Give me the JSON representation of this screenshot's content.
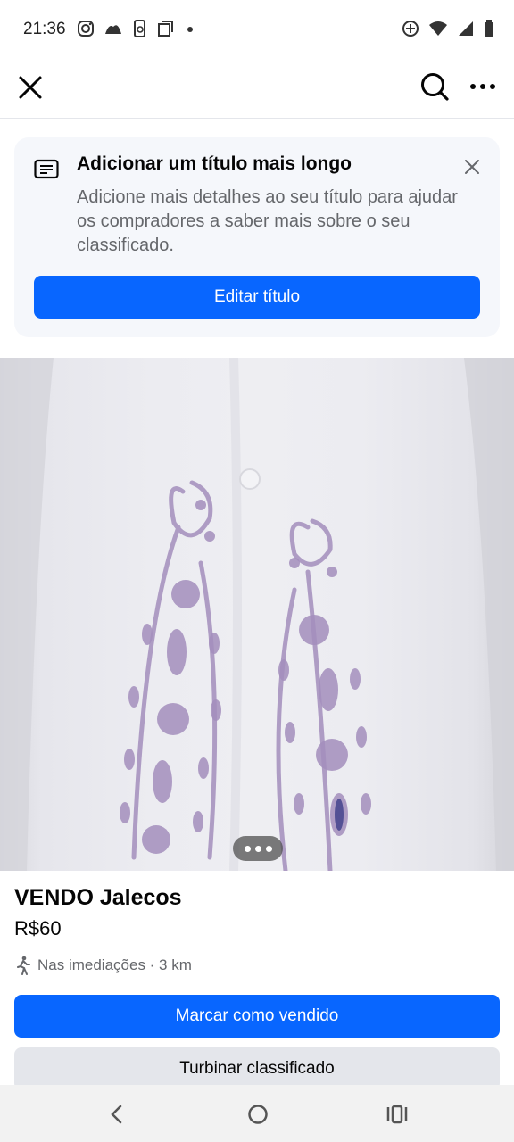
{
  "status_bar": {
    "time": "21:36",
    "left_icons": [
      "instagram-icon",
      "bank-icon",
      "phone-sync-icon",
      "copy-icon",
      "dot-icon"
    ],
    "right_icons": [
      "add-circle-icon",
      "wifi-icon",
      "signal-icon",
      "battery-icon"
    ]
  },
  "top_bar": {
    "close_icon": "close-icon",
    "search_icon": "search-icon",
    "more_icon": "more-icon"
  },
  "banner": {
    "icon": "text-lines-icon",
    "title": "Adicionar um título mais longo",
    "body": "Adicione mais detalhes ao seu título para ajudar os compradores a saber mais sobre o seu classificado.",
    "button_label": "Editar título",
    "close_icon": "close-icon"
  },
  "listing": {
    "photo_icon": "more-photos-icon",
    "title": "VENDO Jalecos",
    "price": "R$60",
    "location": "Nas imediações · 3 km",
    "location_icon": "walking-icon"
  },
  "actions": {
    "mark_sold_label": "Marcar como vendido",
    "boost_label": "Turbinar classificado"
  },
  "nav_bar": {
    "back_icon": "back-icon",
    "home_icon": "home-icon",
    "recents_icon": "recents-icon"
  },
  "colors": {
    "primary": "#0866ff",
    "secondary_button": "#e4e6eb",
    "banner_bg": "#f5f7fb",
    "muted_text": "#65676b"
  }
}
